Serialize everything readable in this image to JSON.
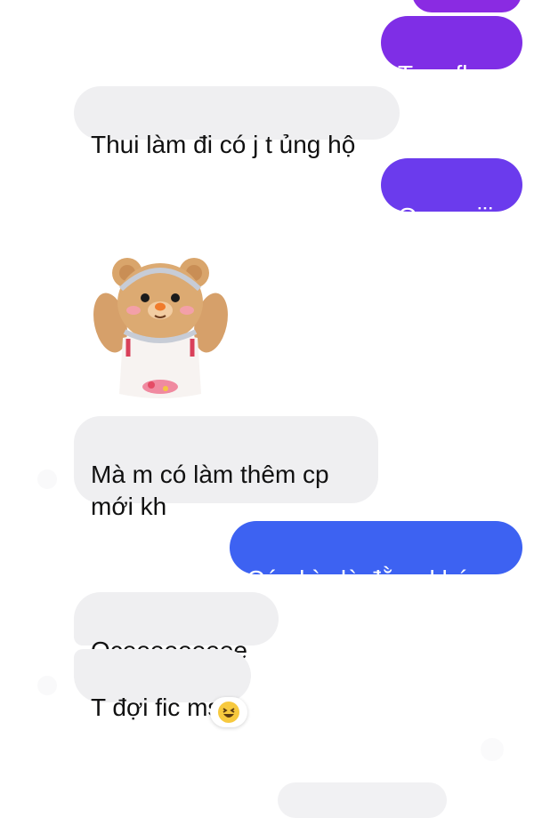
{
  "colors": {
    "outgoing_gradient_top": "#8a2be2",
    "outgoing_gradient_bottom": "#2f6cf0",
    "incoming_bubble": "#efeff1"
  },
  "messages": [
    {
      "id": "m1",
      "side": "out",
      "text": ""
    },
    {
      "id": "m2",
      "side": "out",
      "text": "T sợ flop"
    },
    {
      "id": "m3",
      "side": "in",
      "text": "Thui làm đi có j t ủng hộ"
    },
    {
      "id": "m4",
      "side": "out",
      "text": "Oce ociii"
    },
    {
      "id": "m5",
      "side": "in",
      "sticker": "teddy-bear-sticker"
    },
    {
      "id": "m6",
      "side": "in",
      "text": "Mà m có làm thêm cp\nmới kh"
    },
    {
      "id": "m7",
      "side": "out",
      "text": "Có nhìu là đằng khác"
    },
    {
      "id": "m8",
      "side": "in",
      "text": "Oceeeeeeeee"
    },
    {
      "id": "m9",
      "side": "in",
      "text": "T đợi fic ms",
      "reaction": "laughing-face-icon"
    }
  ]
}
